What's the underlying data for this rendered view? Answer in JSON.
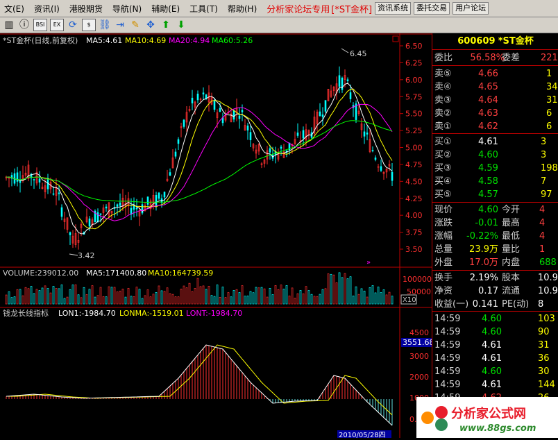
{
  "menu": {
    "items": [
      "文(E)",
      "资讯(I)",
      "港股期货",
      "导航(N)",
      "辅助(E)",
      "工具(T)",
      "帮助(H)"
    ],
    "brand": "分析家论坛专用",
    "stock_tag": "[*ST金杯]",
    "buttons": [
      "资讯系统",
      "委托交易",
      "用户论坛"
    ]
  },
  "toolbar": {
    "icons": [
      "k-line-icon",
      "info-icon",
      "bsi-icon",
      "box-icon",
      "refresh-icon",
      "dollar-icon",
      "link-icon",
      "export-icon",
      "pencil-icon",
      "move-icon",
      "up-arrow-icon",
      "down-arrow-icon"
    ],
    "labels": [
      "",
      "",
      "BSI",
      "EX",
      "",
      "$",
      "",
      "",
      "",
      "",
      "",
      ""
    ]
  },
  "main_chart": {
    "title": "*ST金杯(日线,前复权)",
    "ma5": "MA5:4.61",
    "ma10": "MA10:4.69",
    "ma20": "MA20:4.94",
    "ma60": "MA60:5.26",
    "high_label": "6.45",
    "low_label": "3.42",
    "price_ticks": [
      "6.50",
      "6.25",
      "6.00",
      "5.75",
      "5.50",
      "5.25",
      "5.00",
      "4.75",
      "4.50",
      "4.25",
      "4.00",
      "3.75",
      "3.50"
    ],
    "colors": {
      "ma5": "#ffffff",
      "ma10": "#ffff00",
      "ma20": "#ff00ff",
      "ma60": "#00ff00",
      "up": "#ff3030",
      "down": "#00ffff"
    }
  },
  "volume": {
    "label": "VOLUME:239012.00",
    "ma5": "MA5:171400.80",
    "ma10": "MA10:164739.59",
    "ticks": [
      "100000",
      "50000"
    ],
    "unit": "X10"
  },
  "indicator": {
    "name": "钱龙长线指标",
    "lon": "LON1:-1984.70",
    "lonma": "LONMA:-1519.01",
    "lont": "LONT:-1984.70",
    "ticks": [
      "4500",
      "3000",
      "2000",
      "1000",
      "0.00"
    ],
    "cursor_value": "3551.68",
    "date_tag": "2010/05/28四"
  },
  "quote": {
    "code": "600609",
    "name": "*ST金杯",
    "weibi_label": "委比",
    "weibi": "56.58%",
    "weicha_label": "委差",
    "weicha": "221",
    "sell": [
      {
        "label": "卖⑤",
        "price": "4.66",
        "vol": "1"
      },
      {
        "label": "卖④",
        "price": "4.65",
        "vol": "34"
      },
      {
        "label": "卖③",
        "price": "4.64",
        "vol": "31"
      },
      {
        "label": "卖②",
        "price": "4.63",
        "vol": "6"
      },
      {
        "label": "卖①",
        "price": "4.62",
        "vol": "6"
      }
    ],
    "buy": [
      {
        "label": "买①",
        "price": "4.61",
        "vol": "3"
      },
      {
        "label": "买②",
        "price": "4.60",
        "vol": "3"
      },
      {
        "label": "买③",
        "price": "4.59",
        "vol": "198"
      },
      {
        "label": "买④",
        "price": "4.58",
        "vol": "7"
      },
      {
        "label": "买⑤",
        "price": "4.57",
        "vol": "97"
      }
    ],
    "stats": [
      {
        "l1": "现价",
        "v1": "4.60",
        "c1": "green",
        "l2": "今开",
        "v2": "4"
      },
      {
        "l1": "涨跌",
        "v1": "-0.01",
        "c1": "green",
        "l2": "最高",
        "v2": "4"
      },
      {
        "l1": "涨幅",
        "v1": "-0.22%",
        "c1": "green",
        "l2": "最低",
        "v2": "4"
      },
      {
        "l1": "总量",
        "v1": "23.9万",
        "c1": "yellow",
        "l2": "量比",
        "v2": "1"
      },
      {
        "l1": "外盘",
        "v1": "17.0万",
        "c1": "red",
        "l2": "内盘",
        "v2": "688"
      }
    ],
    "fin": [
      {
        "l1": "换手",
        "v1": "2.19%",
        "l2": "股本",
        "v2": "10.9"
      },
      {
        "l1": "净资",
        "v1": "0.17",
        "l2": "流通",
        "v2": "10.9"
      },
      {
        "l1": "收益(一)",
        "v1": "0.141",
        "l2": "PE(动)",
        "v2": "8"
      }
    ],
    "ticks": [
      {
        "time": "14:59",
        "price": "4.60",
        "color": "green",
        "vol": "103"
      },
      {
        "time": "14:59",
        "price": "4.60",
        "color": "green",
        "vol": "90"
      },
      {
        "time": "14:59",
        "price": "4.61",
        "color": "white",
        "vol": "31"
      },
      {
        "time": "14:59",
        "price": "4.61",
        "color": "white",
        "vol": "36"
      },
      {
        "time": "14:59",
        "price": "4.60",
        "color": "green",
        "vol": "30"
      },
      {
        "time": "14:59",
        "price": "4.61",
        "color": "white",
        "vol": "144"
      },
      {
        "time": "14:59",
        "price": "4.62",
        "color": "red",
        "vol": "26"
      }
    ]
  },
  "watermark": {
    "text": "分析家公式网",
    "url": "www.88gs.com"
  }
}
